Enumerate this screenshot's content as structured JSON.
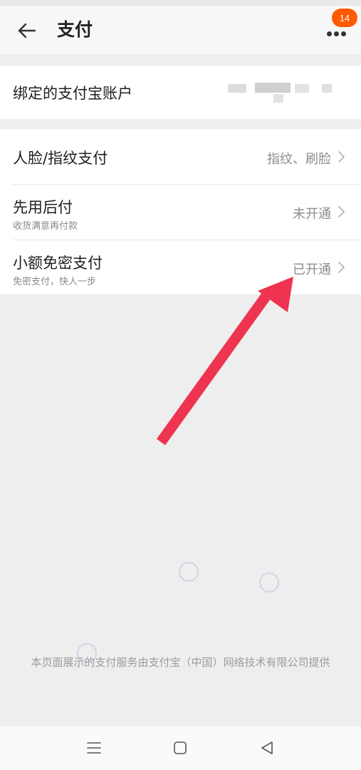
{
  "header": {
    "title": "支付",
    "badge_count": "14"
  },
  "account": {
    "label": "绑定的支付宝账户"
  },
  "settings": [
    {
      "title": "人脸/指纹支付",
      "subtitle": "",
      "value": "指纹、刷脸"
    },
    {
      "title": "先用后付",
      "subtitle": "收货满意再付款",
      "value": "未开通"
    },
    {
      "title": "小额免密支付",
      "subtitle": "免密支付，快人一步",
      "value": "已开通"
    }
  ],
  "footer": {
    "note": "本页面展示的支付服务由支付宝（中国）网络技术有限公司提供"
  },
  "colors": {
    "badge": "#ff5a00",
    "arrow": "#ee3450",
    "background": "#eeeeee"
  }
}
